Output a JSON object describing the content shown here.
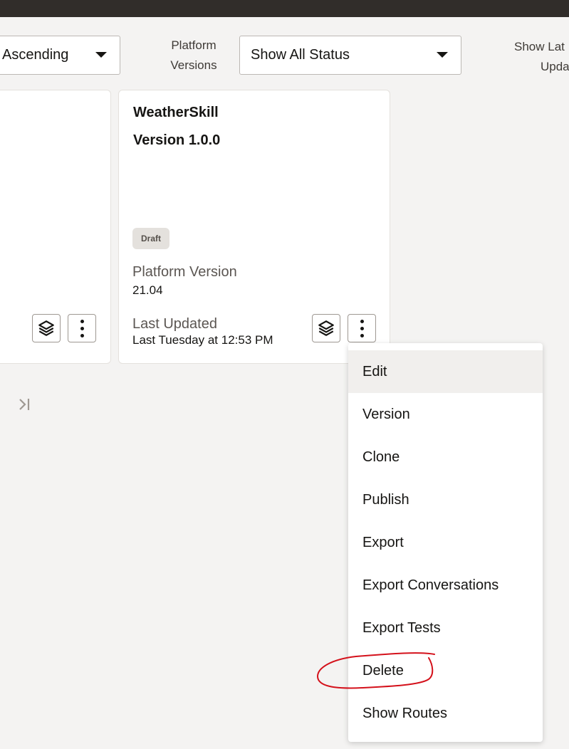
{
  "filters": {
    "sort_value": "Ascending",
    "platform_label_line1": "Platform",
    "platform_label_line2": "Versions",
    "status_value": "Show All Status",
    "latest_label_line1": "Show Lat",
    "latest_label_line2": "Upda"
  },
  "card": {
    "name": "WeatherSkill",
    "version": "Version 1.0.0",
    "status_badge": "Draft",
    "platform_version_label": "Platform Version",
    "platform_version_value": "21.04",
    "last_updated_label": "Last Updated",
    "last_updated_value": "Last Tuesday at 12:53 PM"
  },
  "icons": {
    "layers": "layers-icon",
    "more": "more-vertical-icon",
    "last_page": "last-page-icon",
    "dropdown": "chevron-down-icon"
  },
  "context_menu": {
    "items": [
      {
        "label": "Edit"
      },
      {
        "label": "Version"
      },
      {
        "label": "Clone"
      },
      {
        "label": "Publish"
      },
      {
        "label": "Export"
      },
      {
        "label": "Export Conversations"
      },
      {
        "label": "Export Tests"
      },
      {
        "label": "Delete"
      },
      {
        "label": "Show Routes"
      }
    ],
    "highlighted": "Edit",
    "annotated": "Delete"
  },
  "colors": {
    "topbar": "#312d2a",
    "background": "#f4f3f2",
    "annotation": "#d4111b"
  }
}
